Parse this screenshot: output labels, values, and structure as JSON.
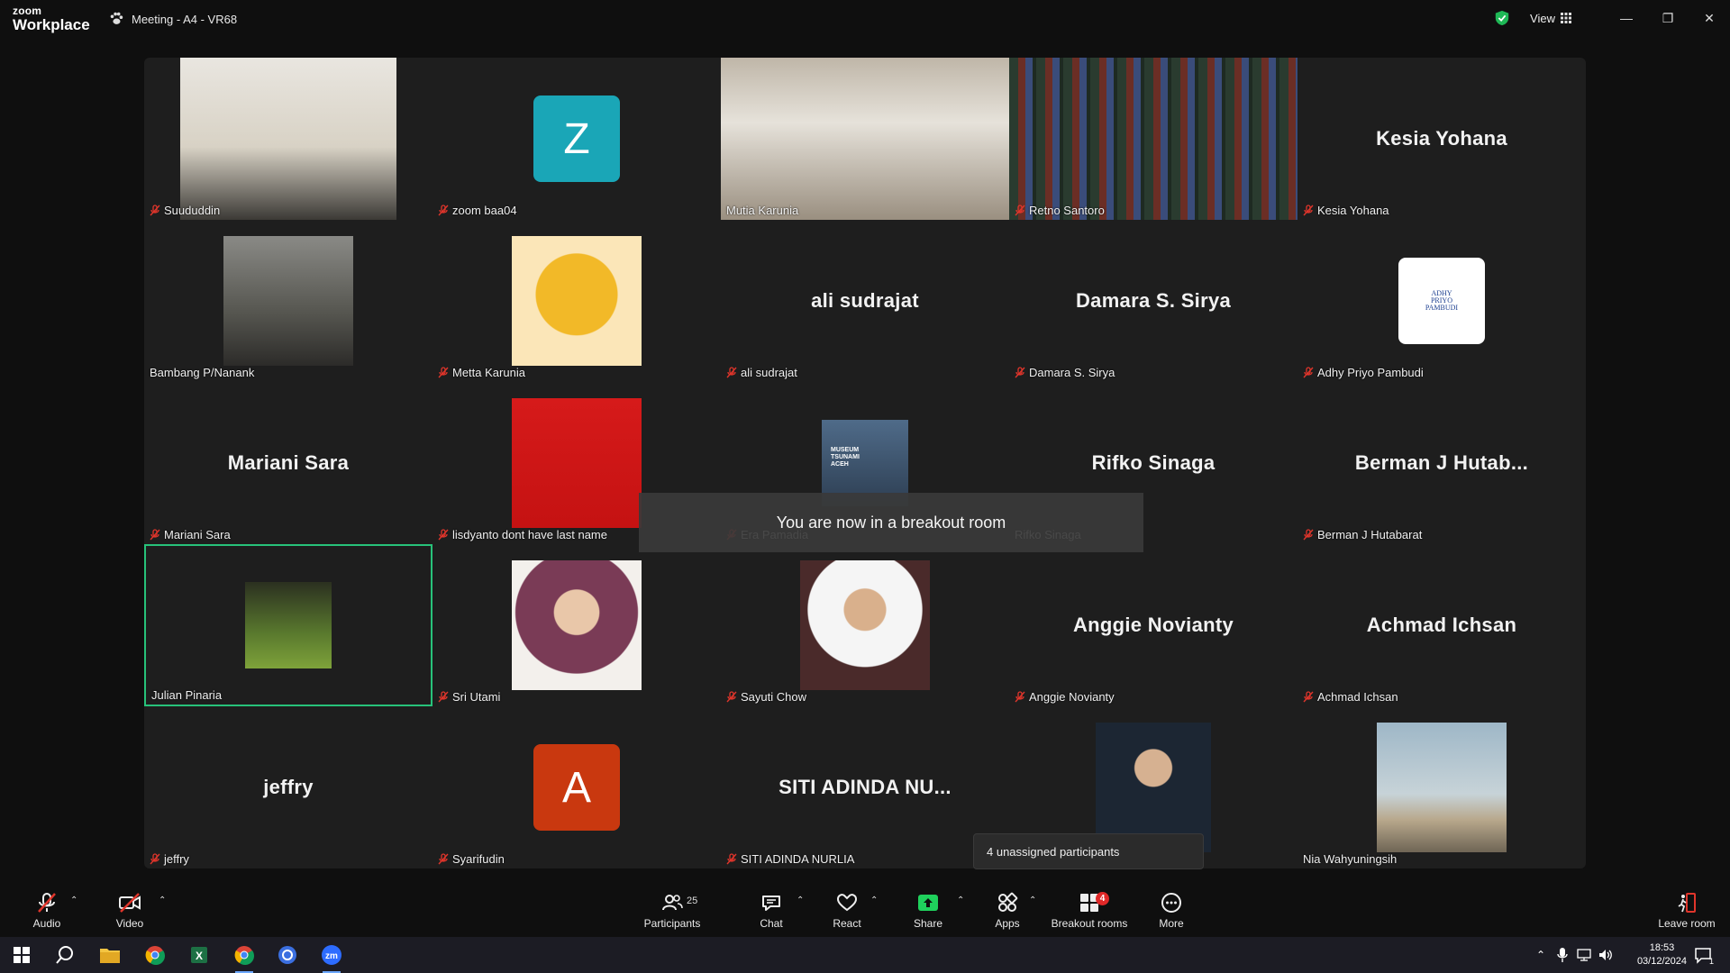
{
  "app": {
    "logo_line1": "zoom",
    "logo_line2": "Workplace",
    "meeting_title": "Meeting - A4 - VR68",
    "view_label": "View"
  },
  "participants": [
    {
      "name": "Suududdin",
      "kind": "photo",
      "muted": true
    },
    {
      "name": "zoom baa04",
      "kind": "letter",
      "letter": "Z",
      "color": "#1aa6b7",
      "muted": true
    },
    {
      "name": "Mutia Karunia",
      "kind": "photo",
      "muted": false
    },
    {
      "name": "Retno Santoro",
      "kind": "photo",
      "muted": true
    },
    {
      "name": "Kesia Yohana",
      "kind": "text",
      "display": "Kesia Yohana",
      "muted": true
    },
    {
      "name": "Bambang P/Nanank",
      "kind": "photo",
      "muted": false
    },
    {
      "name": "Metta Karunia",
      "kind": "photo",
      "muted": true
    },
    {
      "name": "ali sudrajat",
      "kind": "text",
      "display": "ali sudrajat",
      "muted": true
    },
    {
      "name": "Damara S. Sirya",
      "kind": "text",
      "display": "Damara S. Sirya",
      "muted": true
    },
    {
      "name": "Adhy Priyo Pambudi",
      "kind": "logo",
      "logo_text": [
        "ADHY",
        "PRIYO",
        "PAMBUDI"
      ],
      "muted": true
    },
    {
      "name": "Mariani Sara",
      "kind": "text",
      "display": "Mariani Sara",
      "muted": true
    },
    {
      "name": "lisdyanto dont have last name",
      "kind": "photo",
      "muted": true
    },
    {
      "name": "Era Pamadia",
      "kind": "photo",
      "photo_text": [
        "MUSEUM",
        "TSUNAMI",
        "ACEH"
      ],
      "muted": true
    },
    {
      "name": "Rifko Sinaga",
      "kind": "text",
      "display": "Rifko Sinaga",
      "muted": false
    },
    {
      "name": "Berman J Hutabarat",
      "kind": "text",
      "display": "Berman J Hutab...",
      "muted": true
    },
    {
      "name": "Julian Pinaria",
      "kind": "photo",
      "muted": false,
      "active": true
    },
    {
      "name": "Sri Utami",
      "kind": "photo",
      "muted": true
    },
    {
      "name": "Sayuti Chow",
      "kind": "photo",
      "muted": true
    },
    {
      "name": "Anggie Novianty",
      "kind": "text",
      "display": "Anggie Novianty",
      "muted": true
    },
    {
      "name": "Achmad Ichsan",
      "kind": "text",
      "display": "Achmad Ichsan",
      "muted": true
    },
    {
      "name": "jeffry",
      "kind": "text",
      "display": "jeffry",
      "muted": true
    },
    {
      "name": "Syarifudin",
      "kind": "letter",
      "letter": "A",
      "color": "#c9380f",
      "muted": true
    },
    {
      "name": "SITI ADINDA NURLIA",
      "kind": "text",
      "display": "SITI ADINDA NU...",
      "muted": true
    },
    {
      "name": "",
      "kind": "photo",
      "muted": false
    },
    {
      "name": "Nia Wahyuningsih",
      "kind": "photo",
      "muted": false
    }
  ],
  "toast": "You are now in a breakout room",
  "tooltip": "4 unassigned participants",
  "toolbar": {
    "audio": "Audio",
    "video": "Video",
    "participants": "Participants",
    "participants_count": "25",
    "chat": "Chat",
    "react": "React",
    "share": "Share",
    "apps": "Apps",
    "breakout": "Breakout rooms",
    "breakout_badge": "4",
    "more": "More",
    "leave": "Leave room"
  },
  "taskbar": {
    "time": "18:53",
    "date": "03/12/2024",
    "notification_count": "1"
  },
  "colors": {
    "active_border": "#27c27a",
    "share_green": "#1fd15c",
    "mute_red": "#e0352b"
  }
}
